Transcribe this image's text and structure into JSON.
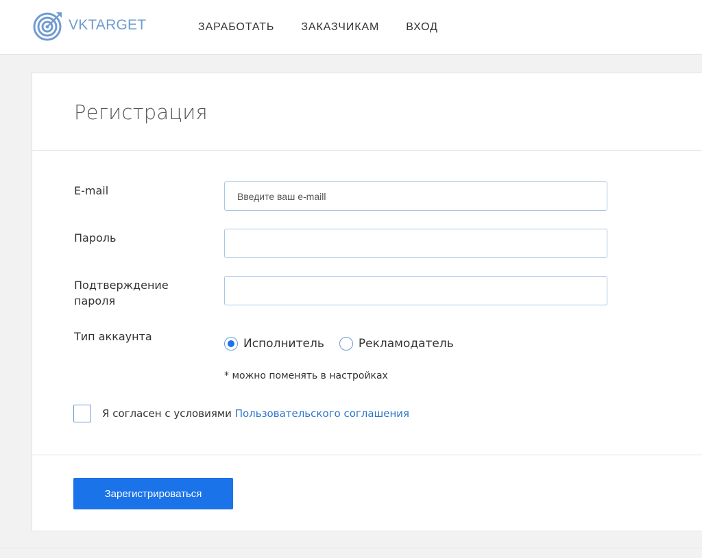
{
  "header": {
    "logo_text": "VKTARGET",
    "nav": [
      {
        "label": "ЗАРАБОТАТЬ"
      },
      {
        "label": "ЗАКАЗЧИКАМ"
      },
      {
        "label": "ВХОД"
      }
    ]
  },
  "form": {
    "title": "Регистрация",
    "email": {
      "label": "E-mail",
      "placeholder": "Введите ваш e-maill",
      "value": ""
    },
    "password": {
      "label": "Пароль",
      "value": ""
    },
    "confirm": {
      "label_line1": "Подтверждение",
      "label_line2": "пароля",
      "value": ""
    },
    "account_type": {
      "label": "Тип аккаунта",
      "options": [
        {
          "label": "Исполнитель",
          "selected": true
        },
        {
          "label": "Рекламодатель",
          "selected": false
        }
      ],
      "hint": "* можно поменять в настройках"
    },
    "agreement": {
      "text": "Я согласен с условиями ",
      "link_text": "Пользовательского соглашения",
      "checked": false
    },
    "submit_label": "Зарегистрироваться"
  },
  "colors": {
    "accent": "#1a73e8",
    "link": "#2b74c8",
    "logo": "#6f9bd1"
  }
}
